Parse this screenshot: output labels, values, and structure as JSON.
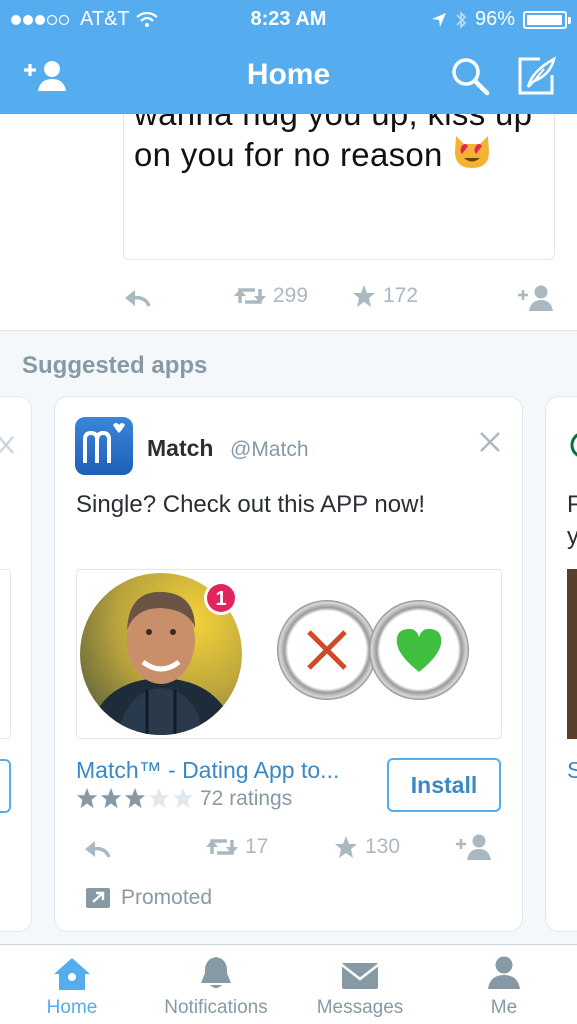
{
  "status_bar": {
    "carrier": "AT&T",
    "time": "8:23 AM",
    "battery_percent_label": "96%",
    "battery_level": 0.96
  },
  "nav": {
    "title": "Home",
    "icons": [
      "add-user-icon",
      "search-icon",
      "compose-icon"
    ]
  },
  "prev_tweet": {
    "text": "wanna hug you up, kiss up on you for no reason",
    "emoji": "heart-eyes-cat-emoji",
    "retweets": "299",
    "favorites": "172"
  },
  "suggested": {
    "title": "Suggested apps",
    "card": {
      "app_name": "Match",
      "handle": "@Match",
      "text": "Single? Check out this APP now!",
      "notification_badge": "1",
      "app_title": "Match™ - Dating App to...",
      "rating_stars": 3,
      "ratings_label": "72 ratings",
      "install_label": "Install",
      "retweets": "17",
      "favorites": "130",
      "promoted_label": "Promoted"
    },
    "right_peek": {
      "text_line1": "F",
      "text_line2": "y",
      "title": "S"
    }
  },
  "tabs": [
    {
      "label": "Home",
      "icon": "home-icon",
      "active": true
    },
    {
      "label": "Notifications",
      "icon": "bell-icon",
      "active": false
    },
    {
      "label": "Messages",
      "icon": "envelope-icon",
      "active": false
    },
    {
      "label": "Me",
      "icon": "person-icon",
      "active": false
    }
  ],
  "colors": {
    "brand": "#55acee",
    "link": "#3b88c3",
    "muted": "#8899a6",
    "background": "#f5f8fa"
  }
}
